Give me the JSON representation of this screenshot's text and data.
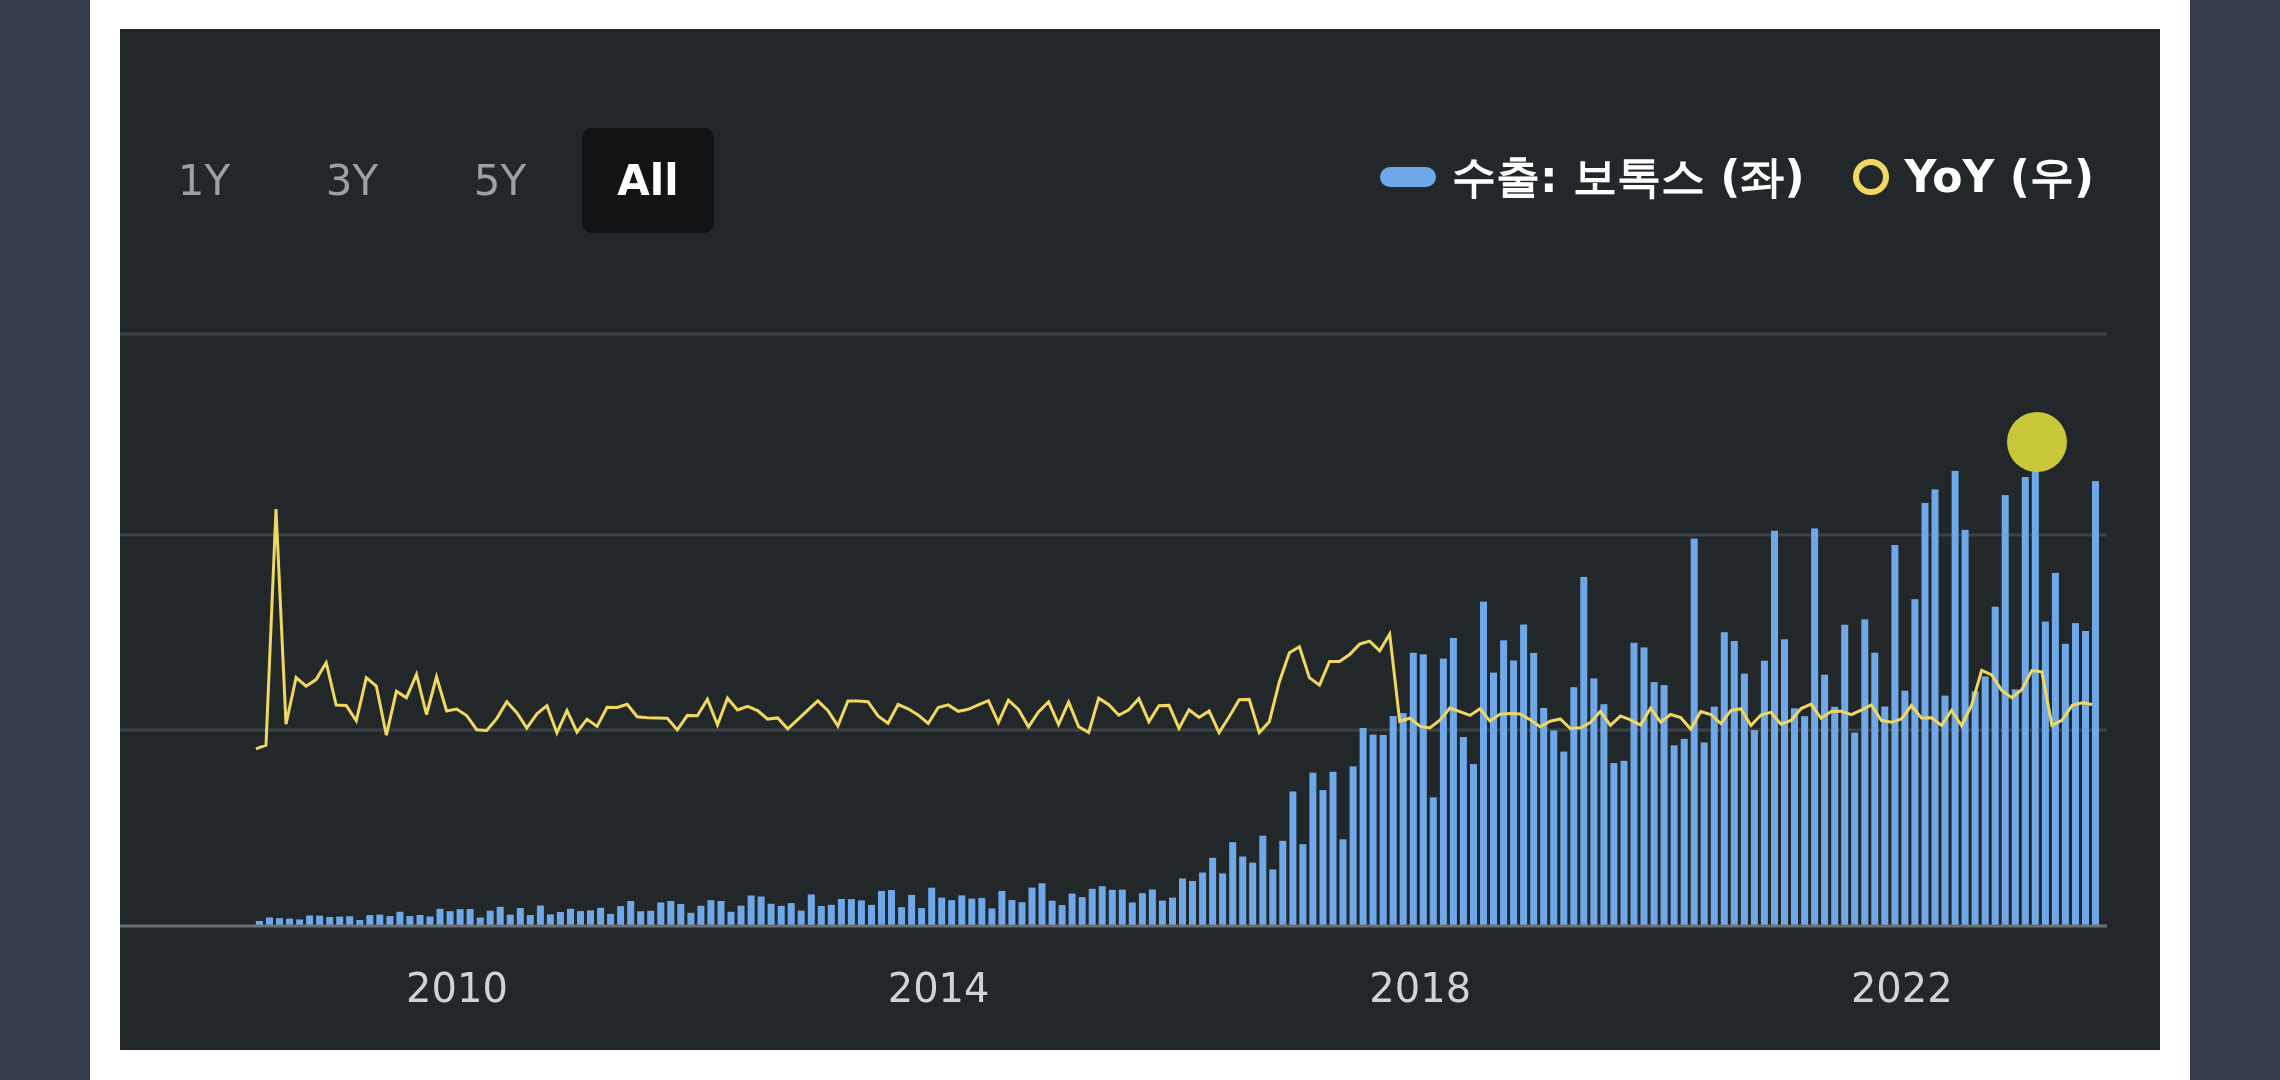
{
  "tabs": [
    {
      "label": "1Y",
      "selected": false
    },
    {
      "label": "3Y",
      "selected": false
    },
    {
      "label": "5Y",
      "selected": false
    },
    {
      "label": "All",
      "selected": true
    }
  ],
  "legend": [
    {
      "label": "수출: 보톡스 (좌)",
      "kind": "bar"
    },
    {
      "label": "YoY (우)",
      "kind": "line"
    }
  ],
  "x_axis_labels": [
    "2010",
    "2014",
    "2018",
    "2022"
  ]
}
